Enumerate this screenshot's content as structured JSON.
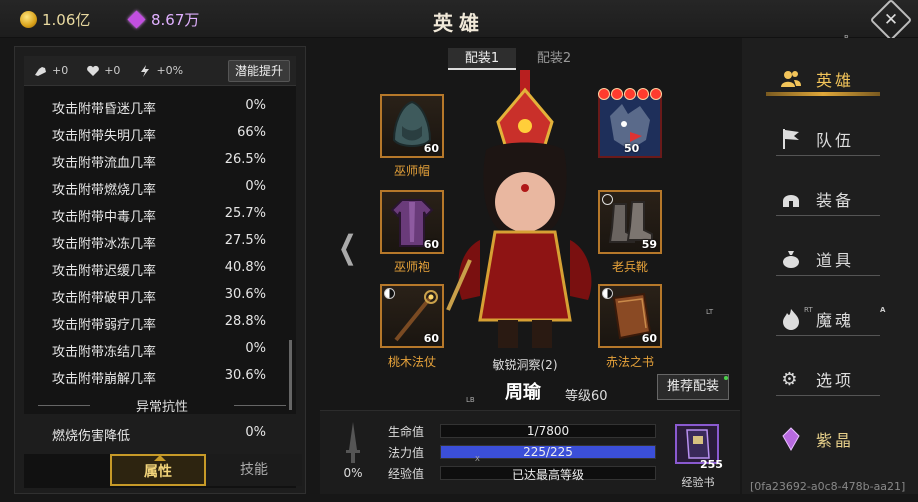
{
  "header": {
    "gold": "1.06亿",
    "gems": "8.67万",
    "title": "英雄",
    "close_icon": "✕",
    "hint_b": "B"
  },
  "potential": {
    "strength": "+0",
    "health": "+0",
    "speed": "+0%",
    "button": "潜能提升"
  },
  "stats": [
    {
      "name": "攻击附带昏迷几率",
      "value": "0%"
    },
    {
      "name": "攻击附带失明几率",
      "value": "66%"
    },
    {
      "name": "攻击附带流血几率",
      "value": "26.5%"
    },
    {
      "name": "攻击附带燃烧几率",
      "value": "0%"
    },
    {
      "name": "攻击附带中毒几率",
      "value": "25.7%"
    },
    {
      "name": "攻击附带冰冻几率",
      "value": "27.5%"
    },
    {
      "name": "攻击附带迟缓几率",
      "value": "40.8%"
    },
    {
      "name": "攻击附带破甲几率",
      "value": "30.6%"
    },
    {
      "name": "攻击附带弱疗几率",
      "value": "28.8%"
    },
    {
      "name": "攻击附带冻结几率",
      "value": "0%"
    },
    {
      "name": "攻击附带崩解几率",
      "value": "30.6%"
    }
  ],
  "section": "异常抗性",
  "resist": {
    "name": "燃烧伤害降低",
    "value": "0%"
  },
  "left_tabs": {
    "attr": "属性",
    "skill": "技能"
  },
  "loadout": {
    "tab1": "配装1",
    "tab2": "配装2"
  },
  "equipment": {
    "hat": {
      "name": "巫师帽",
      "level": "60"
    },
    "robe": {
      "name": "巫师袍",
      "level": "60"
    },
    "staff": {
      "name": "桃木法仗",
      "level": "60"
    },
    "pet": {
      "level": "50",
      "stars": 5
    },
    "boots": {
      "name": "老兵靴",
      "level": "59"
    },
    "book": {
      "name": "赤法之书",
      "level": "60"
    }
  },
  "hero": {
    "skill": "敏锐洞察(2)",
    "name": "周瑜",
    "level": "等级60",
    "recommend": "推荐配装",
    "hint_lb": "LB",
    "hint_lt": "LT"
  },
  "bars": {
    "hp_label": "生命值",
    "hp_value": "1/7800",
    "hp_fraction": 0.0001,
    "mp_label": "法力值",
    "mp_value": "225/225",
    "mp_fraction": 1.0,
    "exp_label": "经验值",
    "exp_value": "已达最高等级",
    "weapon_pct": "0%",
    "hint_x": "X"
  },
  "expbook": {
    "count": "255",
    "label": "经验书"
  },
  "nav": [
    {
      "label": "英雄",
      "icon": "people-icon"
    },
    {
      "label": "队伍",
      "icon": "flag-icon"
    },
    {
      "label": "装备",
      "icon": "helmet-icon"
    },
    {
      "label": "道具",
      "icon": "bag-icon"
    },
    {
      "label": "魔魂",
      "icon": "flame-icon"
    },
    {
      "label": "选项",
      "icon": "gear-icon"
    },
    {
      "label": "紫晶",
      "icon": "crystal-icon"
    }
  ],
  "nav_hints": {
    "rt": "RT",
    "a": "A"
  },
  "session_id": "[0fa23692-a0c8-478b-aa21]",
  "colors": {
    "accent": "#e0a83a",
    "crystal": "#b86ae0",
    "mp_bar": "#3b4fd8"
  }
}
